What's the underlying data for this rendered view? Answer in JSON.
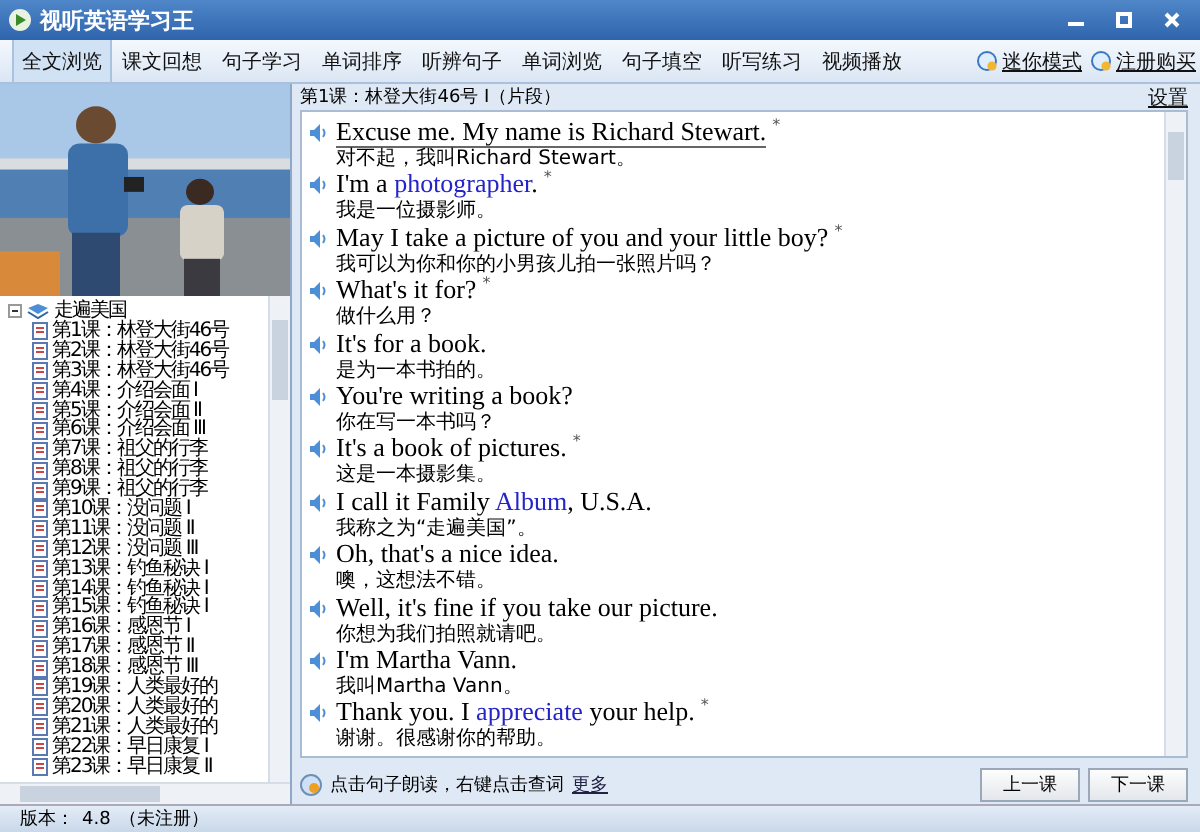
{
  "window": {
    "title": "视听英语学习王"
  },
  "tabs": [
    {
      "label": "全文浏览",
      "selected": true
    },
    {
      "label": "课文回想",
      "selected": false
    },
    {
      "label": "句子学习",
      "selected": false
    },
    {
      "label": "单词排序",
      "selected": false
    },
    {
      "label": "听辨句子",
      "selected": false
    },
    {
      "label": "单词浏览",
      "selected": false
    },
    {
      "label": "句子填空",
      "selected": false
    },
    {
      "label": "听写练习",
      "selected": false
    },
    {
      "label": "视频播放",
      "selected": false
    }
  ],
  "toolbar_links": [
    "迷你模式",
    "注册购买"
  ],
  "video": {
    "kind": "picture"
  },
  "tree": {
    "label": "走遍美国",
    "expanded": true,
    "children": [
      {
        "label": "第1课：林登大街46号"
      },
      {
        "label": "第2课：林登大街46号"
      },
      {
        "label": "第3课：林登大街46号"
      },
      {
        "label": "第4课：介绍会面 I"
      },
      {
        "label": "第5课：介绍会面 II"
      },
      {
        "label": "第6课：介绍会面 III"
      },
      {
        "label": "第7课：祖父的行李"
      },
      {
        "label": "第8课：祖父的行李"
      },
      {
        "label": "第9课：祖父的行李"
      },
      {
        "label": "第10课：没问题 I"
      },
      {
        "label": "第11课：没问题 II"
      },
      {
        "label": "第12课：没问题 III"
      },
      {
        "label": "第13课：钓鱼秘诀 I"
      },
      {
        "label": "第14课：钓鱼秘诀 I"
      },
      {
        "label": "第15课：钓鱼秘诀 I"
      },
      {
        "label": "第16课：感恩节 I"
      },
      {
        "label": "第17课：感恩节 II"
      },
      {
        "label": "第18课：感恩节 III"
      },
      {
        "label": "第19课：人类最好的"
      },
      {
        "label": "第20课：人类最好的"
      },
      {
        "label": "第21课：人类最好的"
      },
      {
        "label": "第22课：早日康复 I"
      },
      {
        "label": "第23课：早日康复 II"
      }
    ]
  },
  "lesson_title": "第1课：林登大街46号 I（片段）",
  "settings_link": "设置",
  "sentences": [
    {
      "selected": true,
      "mark": "*",
      "english": [
        {
          "kind": "plain",
          "text": "Excuse me. My name is Richard Stewart."
        }
      ],
      "chinese": "对不起，我叫Richard Stewart。"
    },
    {
      "selected": false,
      "mark": "*",
      "english": [
        {
          "kind": "plain",
          "text": "I'm a "
        },
        {
          "kind": "word",
          "text": "photographer"
        },
        {
          "kind": "plain",
          "text": "."
        }
      ],
      "chinese": "我是一位摄影师。"
    },
    {
      "selected": false,
      "mark": "*",
      "english": [
        {
          "kind": "plain",
          "text": "May I take a picture of you and your little boy?"
        }
      ],
      "chinese": "我可以为你和你的小男孩儿拍一张照片吗？"
    },
    {
      "selected": false,
      "mark": "*",
      "english": [
        {
          "kind": "plain",
          "text": "What's it for?"
        }
      ],
      "chinese": "做什么用？"
    },
    {
      "selected": false,
      "english": [
        {
          "kind": "plain",
          "text": "It's for a book."
        }
      ],
      "chinese": "是为一本书拍的。"
    },
    {
      "selected": false,
      "english": [
        {
          "kind": "plain",
          "text": "You're writing a book?"
        }
      ],
      "chinese": "你在写一本书吗？"
    },
    {
      "selected": false,
      "mark": "*",
      "english": [
        {
          "kind": "plain",
          "text": "It's a book of pictures."
        }
      ],
      "chinese": "这是一本摄影集。"
    },
    {
      "selected": false,
      "english": [
        {
          "kind": "plain",
          "text": "I call it Family "
        },
        {
          "kind": "word",
          "text": "Album"
        },
        {
          "kind": "plain",
          "text": ", U.S.A."
        }
      ],
      "chinese": "我称之为“走遍美国”。"
    },
    {
      "selected": false,
      "english": [
        {
          "kind": "plain",
          "text": "Oh, that's a nice idea."
        }
      ],
      "chinese": "噢，这想法不错。"
    },
    {
      "selected": false,
      "english": [
        {
          "kind": "plain",
          "text": "Well, it's fine if you take our picture."
        }
      ],
      "chinese": "你想为我们拍照就请吧。"
    },
    {
      "selected": false,
      "english": [
        {
          "kind": "plain",
          "text": "I'm Martha Vann."
        }
      ],
      "chinese": "我叫Martha Vann。"
    },
    {
      "selected": false,
      "mark": "*",
      "english": [
        {
          "kind": "plain",
          "text": "Thank you. I "
        },
        {
          "kind": "word",
          "text": "appreciate"
        },
        {
          "kind": "plain",
          "text": " your help."
        }
      ],
      "chinese": "谢谢。很感谢你的帮助。"
    }
  ],
  "hint": {
    "text": "点击句子朗读，右键点击查词",
    "link": "更多"
  },
  "buttons": [
    "上一课",
    "下一课"
  ],
  "status_bar": {
    "version_label": "版本：",
    "version": "4.8",
    "registration": "（未注册）"
  }
}
